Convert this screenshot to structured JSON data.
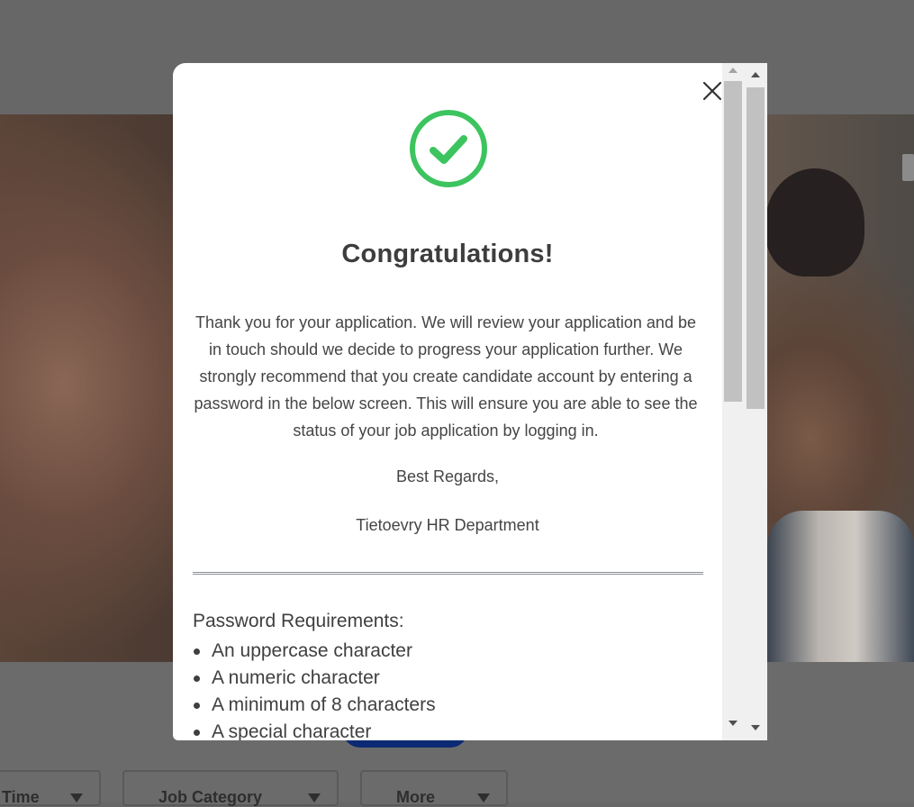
{
  "background": {
    "filters": [
      {
        "label": "Time"
      },
      {
        "label": "Job Category"
      },
      {
        "label": "More"
      }
    ]
  },
  "modal": {
    "status_icon": "check-circle-icon",
    "icon_color": "#3cc45f",
    "title": "Congratulations!",
    "message": "Thank you for your application.  We will review your application and be in touch should we decide to progress your application further. We strongly recommend that you create candidate account by entering a password in the below screen. This will ensure you are able to see the status of your job application by logging in.",
    "regards": "Best Regards,",
    "signature": "Tietoevry HR Department",
    "password_requirements": {
      "heading": "Password Requirements:",
      "items": [
        "An uppercase character",
        "A numeric character",
        "A minimum of 8 characters",
        "A special character"
      ]
    },
    "close_icon": "close-icon"
  }
}
